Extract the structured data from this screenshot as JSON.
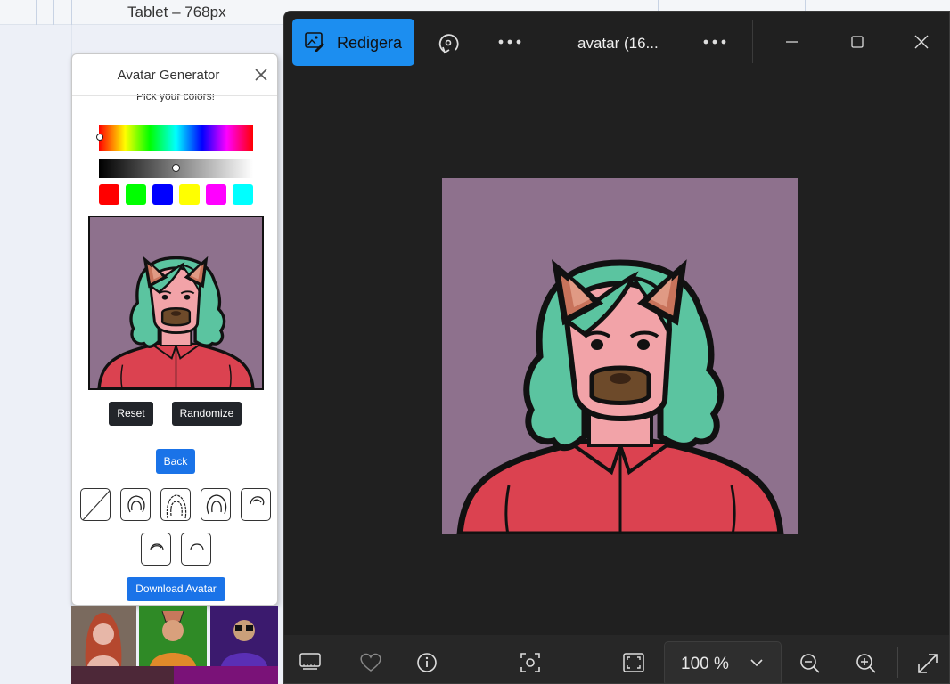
{
  "devtools": {
    "device_label": "Tablet – 768px"
  },
  "generator": {
    "title": "Avatar Generator",
    "pick_colors_label": "Pick your colors!",
    "swatches": [
      "#ff0000",
      "#00ff00",
      "#0000ff",
      "#ffff00",
      "#ff00ff",
      "#00ffff"
    ],
    "reset_label": "Reset",
    "randomize_label": "Randomize",
    "back_label": "Back",
    "download_label": "Download Avatar",
    "hair_options": [
      "none",
      "short-curly",
      "long",
      "medium-curly",
      "bun",
      "bald-short",
      "bald-tuft"
    ]
  },
  "viewer": {
    "edit_label": "Redigera",
    "window_title": "avatar (16...",
    "zoom_level": "100 %"
  },
  "avatar_colors": {
    "background": "#8e718d",
    "hair": "#5bc4a0",
    "skin": "#f2a3a8",
    "shirt": "#db4250",
    "beard": "#6d4a2a",
    "ears": "#c8735b"
  },
  "accent_colors": {
    "edit_button": "#1c8ef0",
    "primary_button": "#1a73e8",
    "dark_button": "#22252a"
  }
}
